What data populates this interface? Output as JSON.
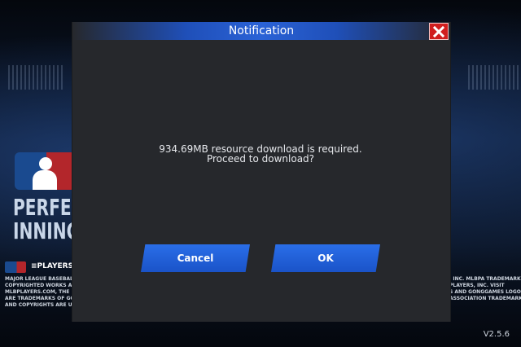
{
  "dialog": {
    "title": "Notification",
    "message_line1": "934.69MB resource download is required.",
    "message_line2": "Proceed to download?",
    "cancel_label": "Cancel",
    "ok_label": "OK"
  },
  "background": {
    "title_line1": "PERFEC",
    "title_line2": "INNING",
    "players_text": "≡PLAYERS<",
    "legal_left": "MAJOR LEAGUE BASEBALL T\nCOPYRIGHTED WORKS AND\nMLBPLAYERS.COM, THE PLA\nARE TRADEMARKS OF GONG\nAND COPYRIGHTS ARE USE",
    "legal_right": ", INC. MLBPA TRADEMARKS,\nPLAYERS, INC. VISIT\nS AND GONGGAMES LOGO\nASSOCIATION TRADEMARKS\n",
    "version": "V2.5.6"
  },
  "colors": {
    "dialog_bg": "#26282c",
    "button_blue": "#1f5fd8",
    "close_red": "#d01e1e",
    "header_blue": "#2a62d6"
  },
  "icons": {
    "close": "close-x-icon",
    "logo": "mlb-logo-icon"
  }
}
